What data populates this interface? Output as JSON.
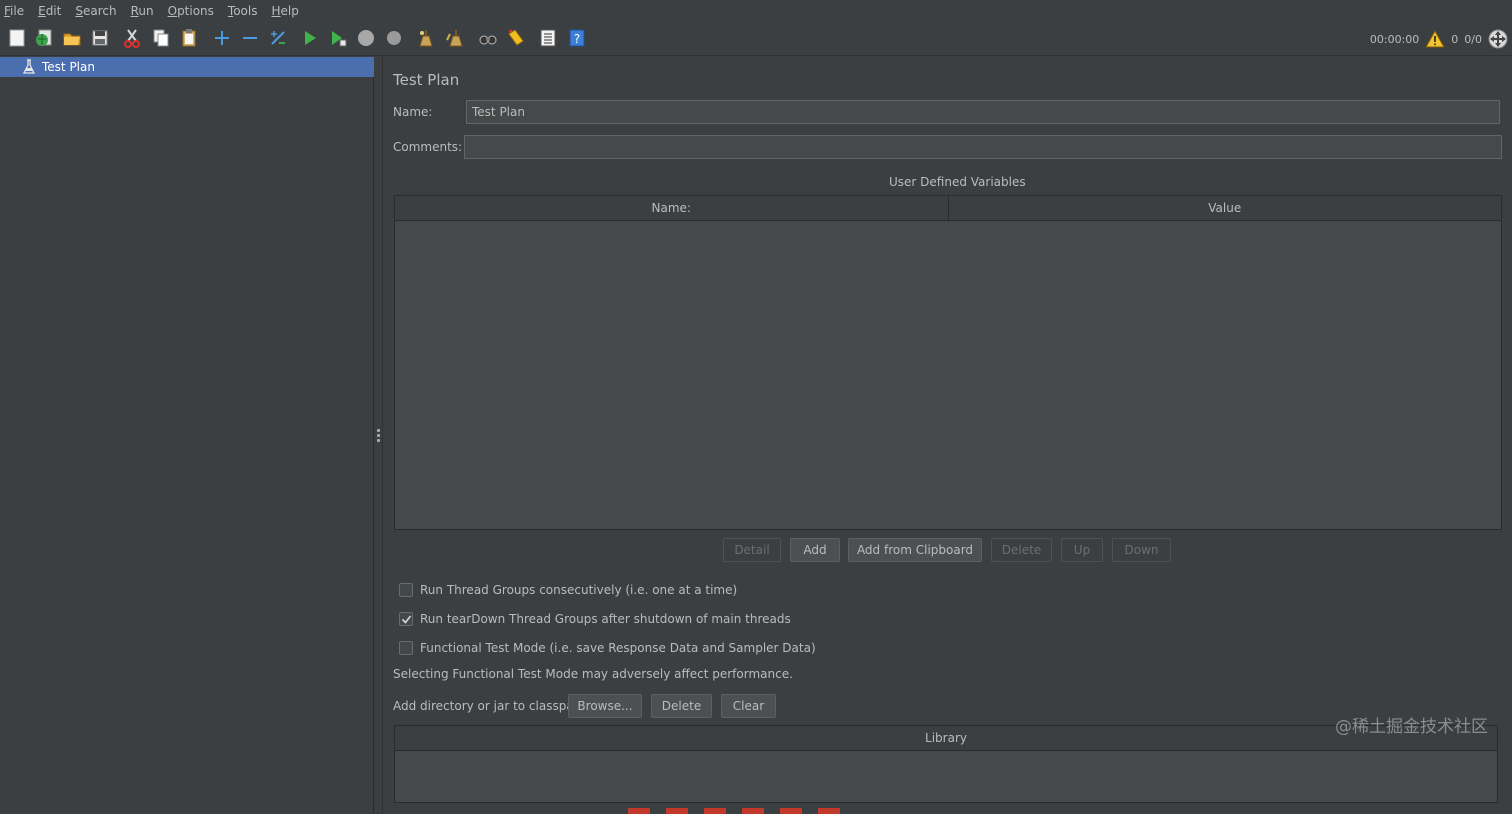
{
  "menubar": {
    "items": [
      {
        "mnemonic": "F",
        "rest": "ile"
      },
      {
        "mnemonic": "E",
        "rest": "dit"
      },
      {
        "mnemonic": "S",
        "rest": "earch"
      },
      {
        "mnemonic": "R",
        "rest": "un"
      },
      {
        "mnemonic": "O",
        "rest": "ptions"
      },
      {
        "mnemonic": "T",
        "rest": "ools"
      },
      {
        "mnemonic": "H",
        "rest": "elp"
      }
    ]
  },
  "toolbar": {
    "icons": [
      "new-icon",
      "templates-icon",
      "open-icon",
      "save-icon",
      "cut-icon",
      "copy-icon",
      "paste-icon",
      "expand-icon",
      "collapse-icon",
      "toggle-icon",
      "start-icon",
      "start-no-pause-icon",
      "stop-icon",
      "shutdown-icon",
      "clear-icon",
      "clear-all-icon",
      "search-icon",
      "reset-search-icon",
      "function-helper-icon",
      "help-icon"
    ],
    "status": {
      "elapsed_time": "00:00:00",
      "warnings": "0",
      "threads": "0/0"
    }
  },
  "tree": {
    "root_label": "Test Plan"
  },
  "test_plan": {
    "title": "Test Plan",
    "name_label": "Name:",
    "name_value": "Test Plan",
    "comments_label": "Comments:",
    "comments_value": "",
    "udv_caption": "User Defined Variables",
    "udv_columns": [
      "Name:",
      "Value"
    ],
    "udv_buttons": {
      "detail": "Detail",
      "add": "Add",
      "add_from_clipboard": "Add from Clipboard",
      "delete": "Delete",
      "up": "Up",
      "down": "Down"
    },
    "options": [
      {
        "label": "Run Thread Groups consecutively (i.e. one at a time)",
        "checked": false
      },
      {
        "label": "Run tearDown Thread Groups after shutdown of main threads",
        "checked": true
      },
      {
        "label": "Functional Test Mode (i.e. save Response Data and Sampler Data)",
        "checked": false
      }
    ],
    "functional_note": "Selecting Functional Test Mode may adversely affect performance.",
    "classpath_label": "Add directory or jar to classpath",
    "classpath_buttons": {
      "browse": "Browse...",
      "delete": "Delete",
      "clear": "Clear"
    },
    "library_column": "Library"
  },
  "watermark": "@稀土掘金技术社区"
}
